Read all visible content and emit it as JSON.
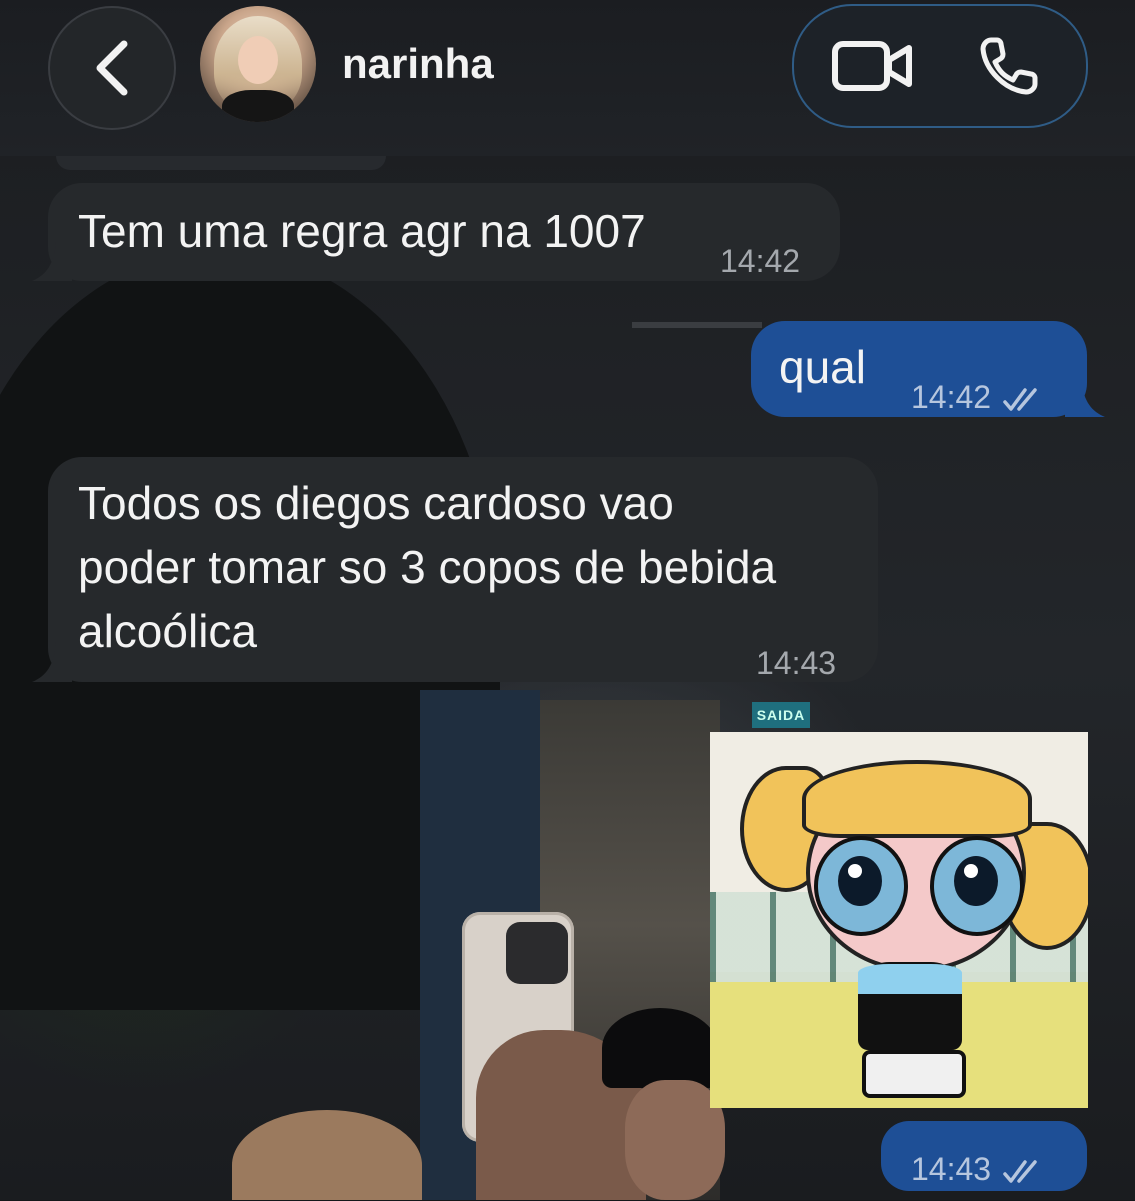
{
  "header": {
    "contact_name": "narinha",
    "back_icon": "chevron-left-icon",
    "video_icon": "video-camera-icon",
    "phone_icon": "phone-icon"
  },
  "messages": [
    {
      "direction": "incoming",
      "text": "Tem uma regra agr na 1007",
      "time": "14:42"
    },
    {
      "direction": "outgoing",
      "text": "qual",
      "time": "14:42",
      "status": "read"
    },
    {
      "direction": "incoming",
      "text": "Todos os diegos cardoso vao\npoder tomar so 3 copos de bebida\nalcoólica",
      "time": "14:43"
    },
    {
      "direction": "outgoing",
      "type": "sticker",
      "sticker": "bubbles-powerpuff-sticker",
      "time": "14:43",
      "status": "read"
    }
  ],
  "wallpaper": {
    "sign_text": "SAIDA"
  },
  "colors": {
    "incoming_bubble": "#26292c",
    "outgoing_bubble": "#1e4f96",
    "header_bg": "#1b1d21",
    "call_pill_border": "#2f5c86"
  }
}
